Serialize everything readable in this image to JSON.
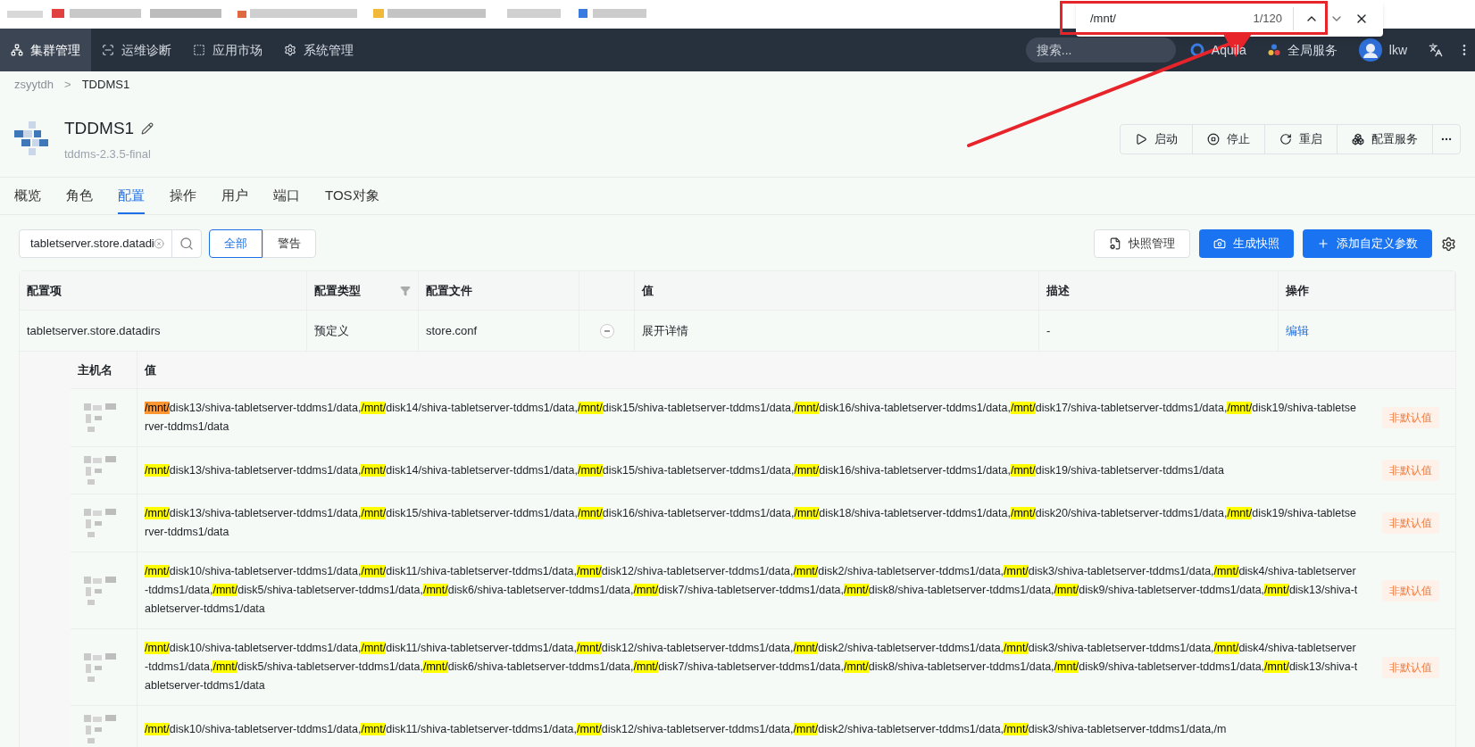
{
  "find_bar": {
    "query": "/mnt/",
    "count": "1/120"
  },
  "nav": {
    "items": [
      {
        "label": "集群管理",
        "selected": true,
        "kind": "cluster"
      },
      {
        "label": "运维诊断",
        "selected": false,
        "kind": "diag"
      },
      {
        "label": "应用市场",
        "selected": false,
        "kind": "market"
      },
      {
        "label": "系统管理",
        "selected": false,
        "kind": "settings"
      }
    ],
    "search": {
      "placeholder": "搜索..."
    },
    "workspace": "Aquila",
    "services": "全局服务",
    "user": "lkw"
  },
  "breadcrumb": {
    "items": [
      "zsyytdh",
      "TDDMS1"
    ],
    "separator": ">"
  },
  "service": {
    "name": "TDDMS1",
    "version": "tddms-2.3.5-final"
  },
  "actions": [
    {
      "label": "启动",
      "kind": "play"
    },
    {
      "label": "停止",
      "kind": "stop"
    },
    {
      "label": "重启",
      "kind": "restart"
    },
    {
      "label": "配置服务",
      "kind": "config"
    }
  ],
  "tabs": [
    {
      "label": "概览",
      "selected": false
    },
    {
      "label": "角色",
      "selected": false
    },
    {
      "label": "配置",
      "selected": true
    },
    {
      "label": "操作",
      "selected": false
    },
    {
      "label": "用户",
      "selected": false
    },
    {
      "label": "端口",
      "selected": false
    },
    {
      "label": "TOS对象",
      "selected": false
    }
  ],
  "filter": {
    "value": "tabletserver.store.datadi",
    "segments": [
      {
        "label": "全部",
        "selected": true
      },
      {
        "label": "警告",
        "selected": false
      }
    ]
  },
  "toolbar": [
    {
      "label": "快照管理",
      "kind": "snapshots",
      "primary": false
    },
    {
      "label": "生成快照",
      "kind": "capture",
      "primary": true
    },
    {
      "label": "添加自定义参数",
      "kind": "add",
      "primary": true
    }
  ],
  "table": {
    "columns": [
      "配置项",
      "配置类型",
      "配置文件",
      "值",
      "描述",
      "操作"
    ],
    "rows": [
      {
        "item": "tabletserver.store.datadirs",
        "type": "预定义",
        "file": "store.conf",
        "expanded": true,
        "value": "展开详情",
        "description": "-",
        "action": "编辑"
      }
    ]
  },
  "detail": {
    "columns": [
      "主机名",
      "值"
    ],
    "rows": [
      {
        "value": "/mnt/disk13/shiva-tabletserver-tddms1/data,/mnt/disk14/shiva-tabletserver-tddms1/data,/mnt/disk15/shiva-tabletserver-tddms1/data,/mnt/disk16/shiva-tabletserver-tddms1/data,/mnt/disk17/shiva-tabletserver-tddms1/data,/mnt/disk19/shiva-tabletserver-tddms1/data",
        "badge": "非默认值"
      },
      {
        "value": "/mnt/disk13/shiva-tabletserver-tddms1/data,/mnt/disk14/shiva-tabletserver-tddms1/data,/mnt/disk15/shiva-tabletserver-tddms1/data,/mnt/disk16/shiva-tabletserver-tddms1/data,/mnt/disk19/shiva-tabletserver-tddms1/data",
        "badge": "非默认值"
      },
      {
        "value": "/mnt/disk13/shiva-tabletserver-tddms1/data,/mnt/disk15/shiva-tabletserver-tddms1/data,/mnt/disk16/shiva-tabletserver-tddms1/data,/mnt/disk18/shiva-tabletserver-tddms1/data,/mnt/disk20/shiva-tabletserver-tddms1/data,/mnt/disk19/shiva-tabletserver-tddms1/data",
        "badge": "非默认值"
      },
      {
        "value": "/mnt/disk10/shiva-tabletserver-tddms1/data,/mnt/disk11/shiva-tabletserver-tddms1/data,/mnt/disk12/shiva-tabletserver-tddms1/data,/mnt/disk2/shiva-tabletserver-tddms1/data,/mnt/disk3/shiva-tabletserver-tddms1/data,/mnt/disk4/shiva-tabletserver-tddms1/data,/mnt/disk5/shiva-tabletserver-tddms1/data,/mnt/disk6/shiva-tabletserver-tddms1/data,/mnt/disk7/shiva-tabletserver-tddms1/data,/mnt/disk8/shiva-tabletserver-tddms1/data,/mnt/disk9/shiva-tabletserver-tddms1/data,/mnt/disk13/shiva-tabletserver-tddms1/data",
        "badge": "非默认值"
      },
      {
        "value": "/mnt/disk10/shiva-tabletserver-tddms1/data,/mnt/disk11/shiva-tabletserver-tddms1/data,/mnt/disk12/shiva-tabletserver-tddms1/data,/mnt/disk2/shiva-tabletserver-tddms1/data,/mnt/disk3/shiva-tabletserver-tddms1/data,/mnt/disk4/shiva-tabletserver-tddms1/data,/mnt/disk5/shiva-tabletserver-tddms1/data,/mnt/disk6/shiva-tabletserver-tddms1/data,/mnt/disk7/shiva-tabletserver-tddms1/data,/mnt/disk8/shiva-tabletserver-tddms1/data,/mnt/disk9/shiva-tabletserver-tddms1/data,/mnt/disk13/shiva-tabletserver-tddms1/data",
        "badge": "非默认值"
      },
      {
        "value": "/mnt/disk10/shiva-tabletserver-tddms1/data,/mnt/disk11/shiva-tabletserver-tddms1/data,/mnt/disk12/shiva-tabletserver-tddms1/data,/mnt/disk2/shiva-tabletserver-tddms1/data,/mnt/disk3/shiva-tabletserver-tddms1/data,/m"
      }
    ]
  }
}
